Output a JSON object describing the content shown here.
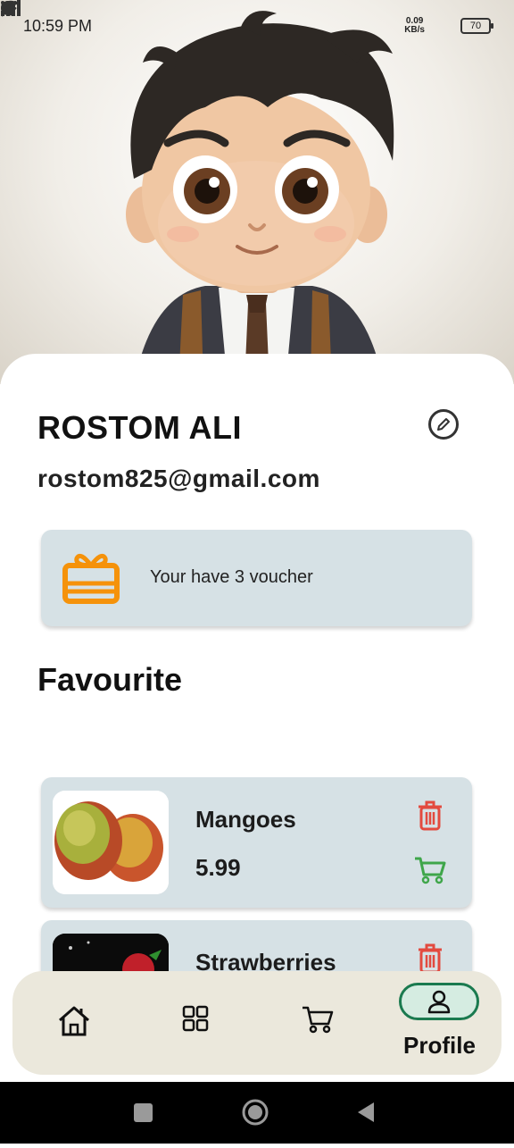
{
  "status_bar": {
    "time": "10:59 PM",
    "net_speed_value": "0.09",
    "net_speed_unit": "KB/s",
    "battery": "70",
    "icons": [
      "messenger-icon",
      "whatsapp-icon",
      "person-add-icon",
      "more-icon",
      "mute-icon",
      "signal-icon",
      "signal-icon",
      "wifi-icon",
      "battery-icon"
    ]
  },
  "profile": {
    "name": "ROSTOM ALI",
    "email": "rostom825@gmail.com",
    "edit_icon": "edit-icon"
  },
  "voucher": {
    "text": "Your have 3 voucher",
    "icon": "gift-icon",
    "icon_color": "#f5920a"
  },
  "favourites": {
    "title": "Favourite",
    "items": [
      {
        "name": "Mangoes",
        "price": "5.99"
      },
      {
        "name": "Strawberries",
        "price": ""
      }
    ]
  },
  "bottom_nav": {
    "items": [
      {
        "icon": "home-icon"
      },
      {
        "icon": "grid-icon"
      },
      {
        "icon": "cart-icon"
      },
      {
        "icon": "profile-icon",
        "label": "Profile",
        "active": true
      }
    ],
    "active_color": "#1a7a4f"
  },
  "colors": {
    "card_bg": "#d6e1e5",
    "delete": "#e34a3f",
    "add_to_cart": "#3fa64a",
    "nav_bg": "#ebe8dc"
  }
}
